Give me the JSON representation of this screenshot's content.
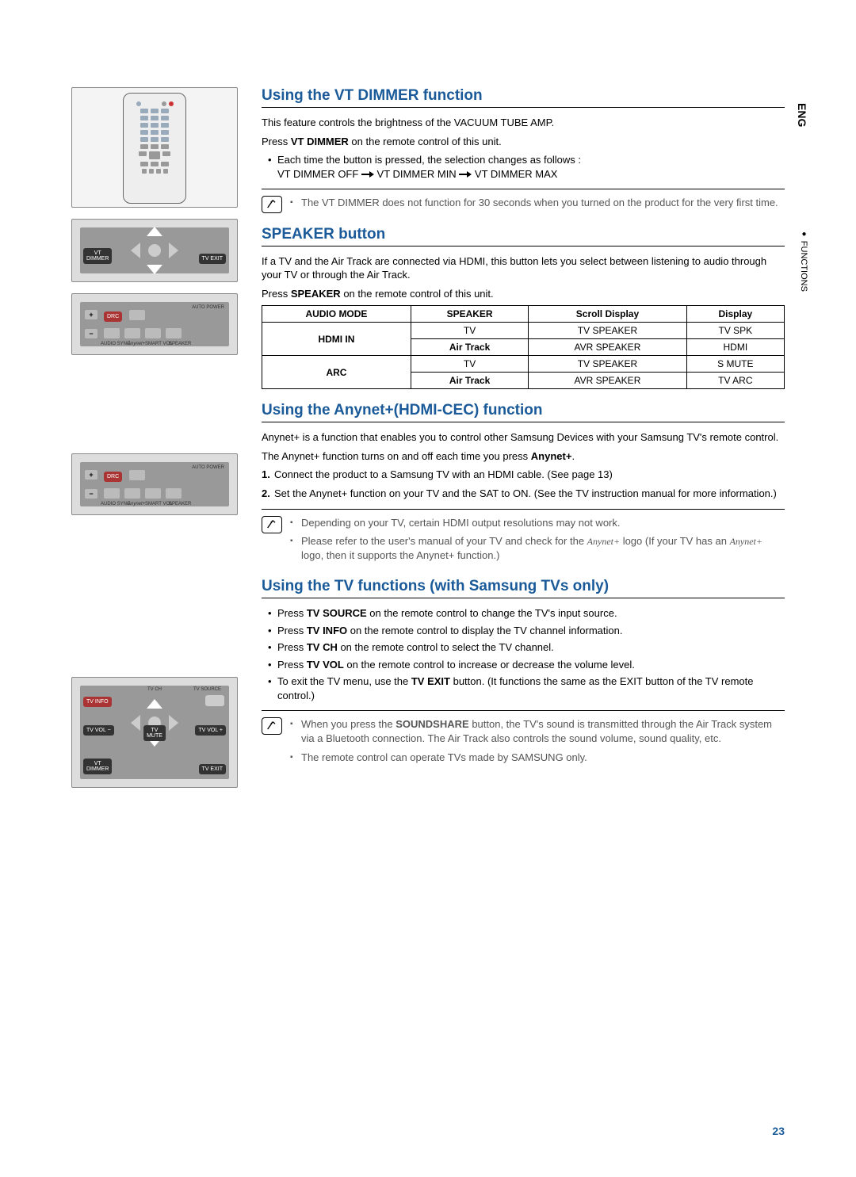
{
  "side": {
    "lang": "ENG",
    "section": "FUNCTIONS"
  },
  "page_number": "23",
  "fig1_labels": {
    "vt_dimmer": "VT\nDIMMER",
    "tv_exit": "TV EXIT"
  },
  "fig2_labels": {
    "drc": "DRC",
    "audio_sync": "AUDIO SYNC",
    "anynet": "Anynet+",
    "smart_vol": "SMART VOL",
    "speaker": "SPEAKER",
    "auto_power": "AUTO POWER"
  },
  "fig3_labels": {
    "drc": "DRC",
    "audio_sync": "AUDIO SYNC",
    "anynet": "Anynet+",
    "smart_vol": "SMART VOL",
    "speaker": "SPEAKER",
    "auto_power": "AUTO POWER"
  },
  "fig4_labels": {
    "tv_ch": "TV CH",
    "tv_source": "TV SOURCE",
    "tv_info": "TV INFO",
    "tv_vol_minus": "TV VOL −",
    "tv_mute": "TV\nMUTE",
    "tv_vol_plus": "TV VOL +",
    "vt_dimmer": "VT\nDIMMER",
    "tv_exit": "TV EXIT"
  },
  "s1": {
    "title": "Using the VT DIMMER function",
    "p1": "This feature controls the brightness of the VACUUM TUBE AMP.",
    "p2a": "Press ",
    "p2b": "VT DIMMER",
    "p2c": " on the remote control of this unit.",
    "b1": "Each time the button is pressed, the selection changes as follows :",
    "seq_a": "VT DIMMER OFF ",
    "seq_b": " VT DIMMER MIN ",
    "seq_c": " VT DIMMER MAX",
    "note1": "The VT DIMMER does not function for 30 seconds when you turned on the product for the very first time."
  },
  "s2": {
    "title": "SPEAKER button",
    "p1": "If a TV and the Air Track are connected via HDMI, this button lets you select between listening to audio through your TV or through the Air Track.",
    "p2a": "Press ",
    "p2b": "SPEAKER",
    "p2c": " on the remote control of this unit.",
    "th1": "AUDIO MODE",
    "th2": "SPEAKER",
    "th3": "Scroll Display",
    "th4": "Display",
    "r1c1": "HDMI IN",
    "r1c2": "TV",
    "r1c3": "TV SPEAKER",
    "r1c4": "TV SPK",
    "r2c2": "Air Track",
    "r2c3": "AVR SPEAKER",
    "r2c4": "HDMI",
    "r3c1": "ARC",
    "r3c2": "TV",
    "r3c3": "TV SPEAKER",
    "r3c4": "S MUTE",
    "r4c2": "Air Track",
    "r4c3": "AVR SPEAKER",
    "r4c4": "TV ARC"
  },
  "s3": {
    "title": "Using the Anynet+(HDMI-CEC) function",
    "p1": "Anynet+ is a function that enables you to control other Samsung Devices with your Samsung TV's remote control.",
    "p2a": "The Anynet+ function turns on and off each time you press ",
    "p2b": "Anynet+",
    "p2c": ".",
    "n1": "1.",
    "o1": "Connect the product to a Samsung TV with an HDMI cable. (See page 13)",
    "n2": "2.",
    "o2": "Set the Anynet+ function on your TV and the SAT to ON. (See the TV instruction manual for more information.)",
    "note1": "Depending on your TV, certain HDMI output resolutions may not work.",
    "note2a": "Please refer to the user's manual of your TV and check for the ",
    "note2b": " logo (If your TV has an ",
    "note2c": " logo, then it supports the Anynet+ function.)",
    "anynet_logo": "Anynet+"
  },
  "s4": {
    "title": "Using the TV functions (with Samsung TVs only)",
    "b1a": "Press ",
    "b1b": "TV SOURCE",
    "b1c": " on the remote control to change the TV's input source.",
    "b2a": "Press ",
    "b2b": "TV INFO",
    "b2c": " on the remote control to display the TV channel information.",
    "b3a": "Press ",
    "b3b": "TV CH",
    "b3c": " on the remote control to select the TV channel.",
    "b4a": "Press ",
    "b4b": "TV VOL",
    "b4c": " on the remote control to increase or decrease the volume level.",
    "b5a": "To exit the TV menu, use the ",
    "b5b": "TV EXIT",
    "b5c": " button. (It functions the same as the EXIT button of the TV remote control.)",
    "note1a": "When you press the ",
    "note1b": "SOUNDSHARE",
    "note1c": " button, the TV's sound is transmitted through the Air Track system via a Bluetooth connection. The Air Track also controls the sound volume, sound quality, etc.",
    "note2": "The remote control can operate TVs made by SAMSUNG only."
  }
}
